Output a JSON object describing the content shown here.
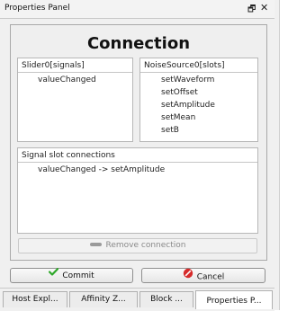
{
  "panel": {
    "title": "Properties Panel",
    "float_icon": "float-window-icon",
    "close_icon": "close-icon"
  },
  "connection": {
    "heading": "Connection",
    "signals": {
      "header": "Slider0[signals]",
      "items": [
        "valueChanged"
      ]
    },
    "slots": {
      "header": "NoiseSource0[slots]",
      "items": [
        "setWaveform",
        "setOffset",
        "setAmplitude",
        "setMean",
        "setB"
      ]
    },
    "connections": {
      "header": "Signal slot connections",
      "items": [
        "valueChanged -> setAmplitude"
      ]
    },
    "remove_label": "Remove connection"
  },
  "actions": {
    "commit_label": "Commit",
    "cancel_label": "Cancel",
    "commit_icon": "checkmark-icon",
    "cancel_icon": "cancel-icon",
    "commit_color": "#2ea82a",
    "cancel_color": "#d62b2b"
  },
  "tabs": [
    {
      "label": "Host Expl..."
    },
    {
      "label": "Affinity Z..."
    },
    {
      "label": "Block ..."
    },
    {
      "label": "Properties P..."
    }
  ],
  "active_tab": "Properties P..."
}
